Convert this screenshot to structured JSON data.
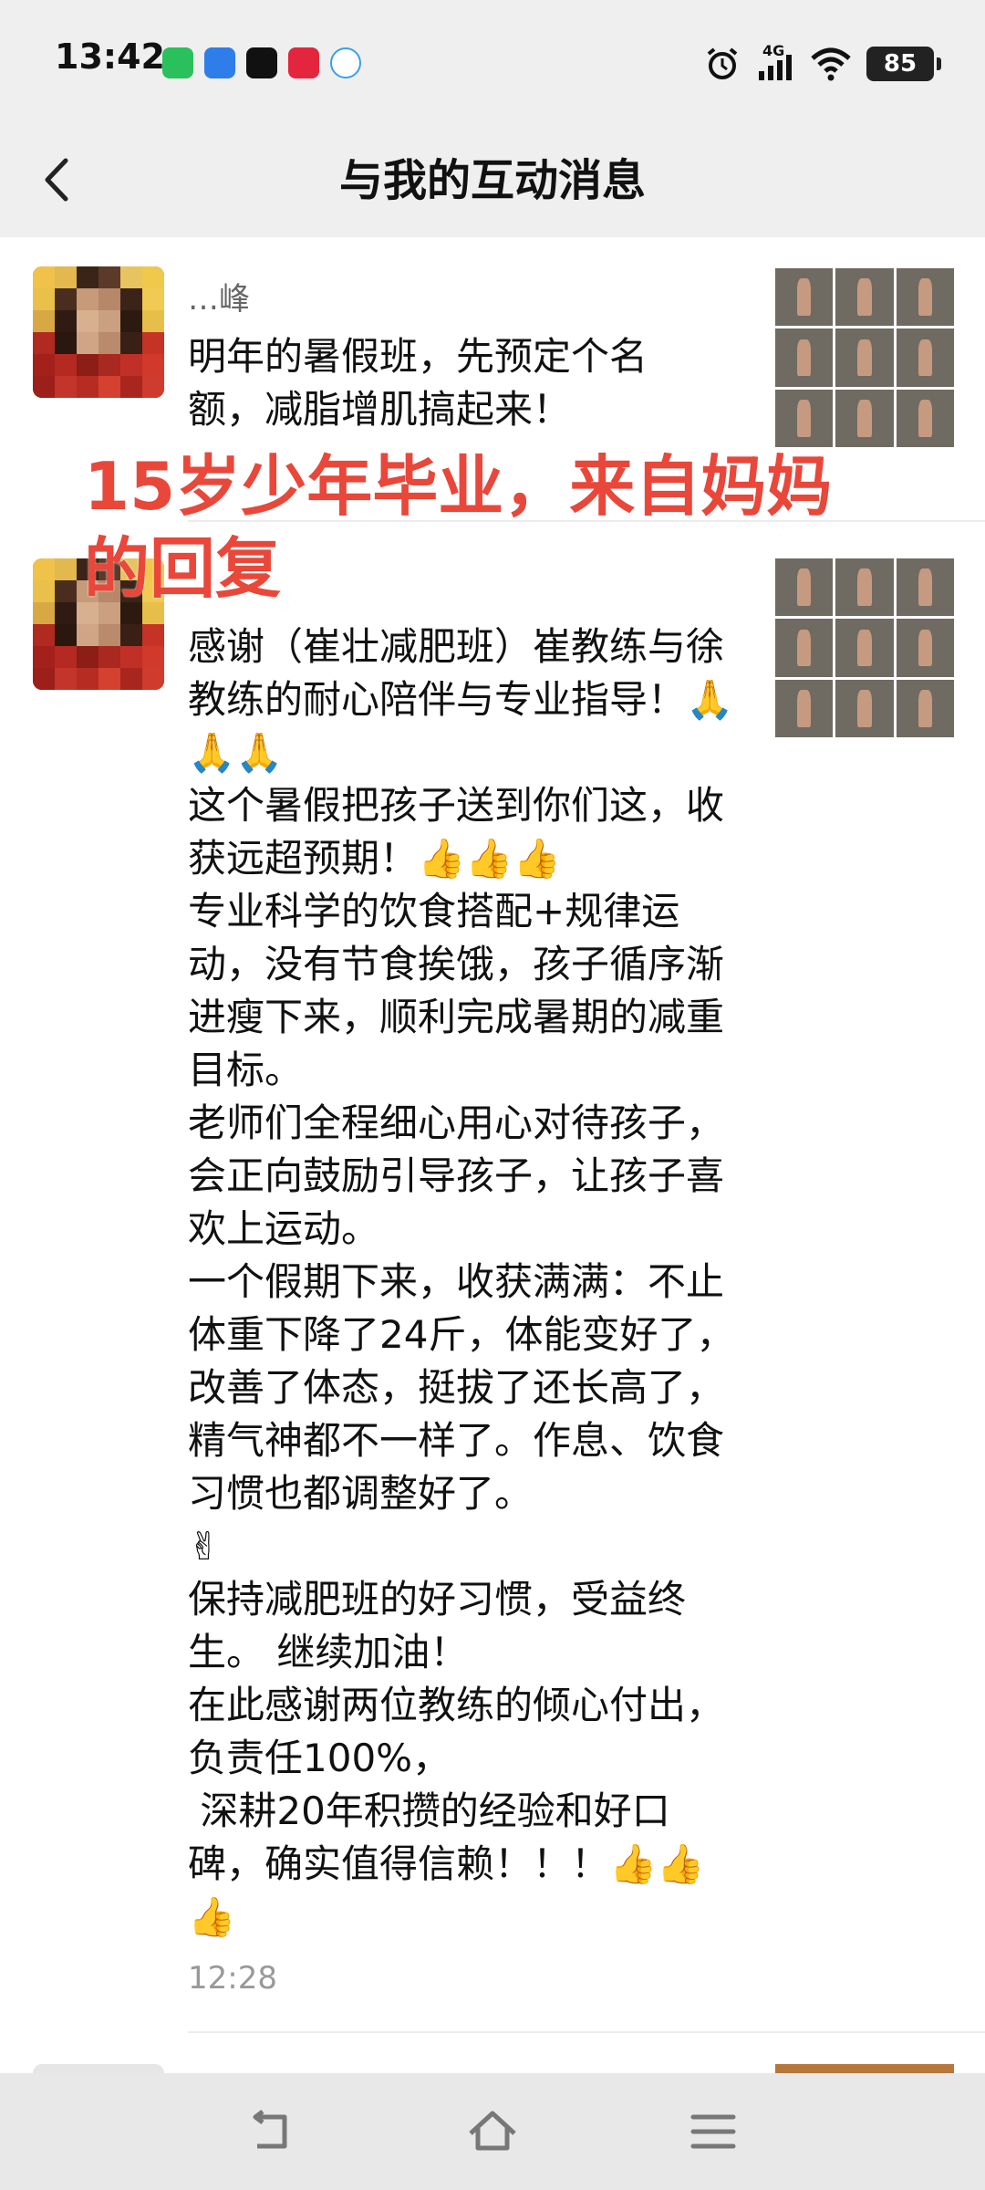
{
  "status_bar": {
    "time": "13:42",
    "network": "4G",
    "battery": "85"
  },
  "header": {
    "title": "与我的互动消息"
  },
  "messages": [
    {
      "username": "…峰",
      "text": "明年的暑假班，先预定个名额，减脂增肌搞起来！"
    },
    {
      "text": "感谢（崔壮减肥班）崔教练与徐教练的耐心陪伴与专业指导！🙏🙏🙏\n这个暑假把孩子送到你们这，收获远超预期！👍👍👍\n专业科学的饮食搭配+规律运动，没有节食挨饿，孩子循序渐进瘦下来，顺利完成暑期的减重目标。\n老师们全程细心用心对待孩子，会正向鼓励引导孩子，让孩子喜欢上运动。\n一个假期下来，收获满满：不止体重下降了24斤，体能变好了，改善了体态，挺拔了还长高了，精气神都不一样了。作息、饮食习惯也都调整好了。\n✌\n保持减肥班的好习惯，受益终生。 继续加油！\n在此感谢两位教练的倾心付出，负责任100%，\n 深耕20年积攒的经验和好口碑，确实值得信赖！！！👍👍\n👍",
      "time": "12:28"
    }
  ],
  "overlay": {
    "caption": "15岁少年毕业，来自妈妈\n的回复"
  },
  "colors": {
    "caption_red": "#e8473a",
    "header_bg": "#efefef"
  },
  "icons": [
    "back-arrow-icon",
    "back-nav-icon",
    "home-nav-icon",
    "menu-nav-icon"
  ]
}
